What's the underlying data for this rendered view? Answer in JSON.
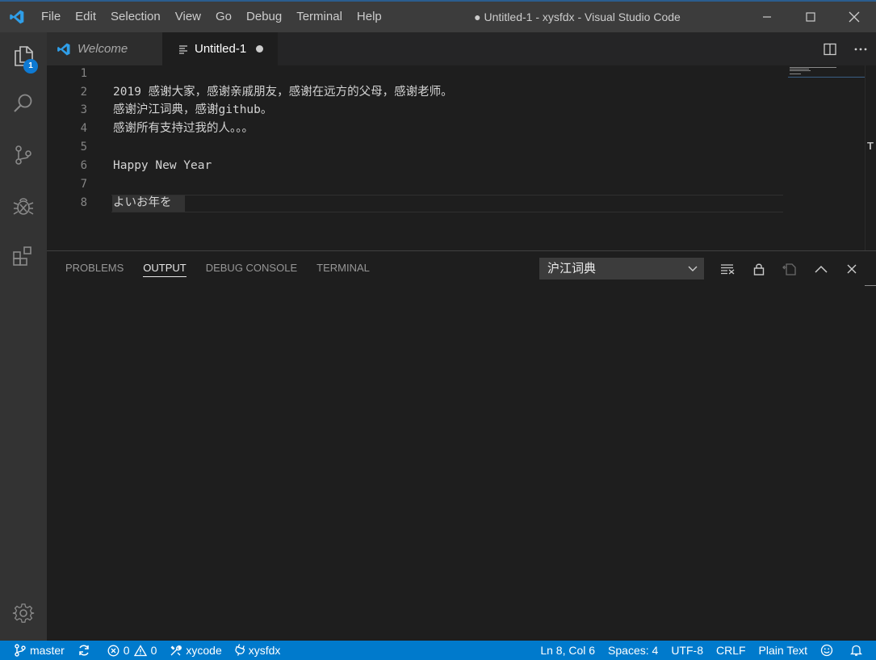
{
  "window": {
    "title": "● Untitled-1 - xysfdx - Visual Studio Code"
  },
  "menu": [
    "File",
    "Edit",
    "Selection",
    "View",
    "Go",
    "Debug",
    "Terminal",
    "Help"
  ],
  "activity_bar": {
    "explorer_badge": "1"
  },
  "tabs": [
    {
      "label": "Welcome",
      "active": false
    },
    {
      "label": "Untitled-1",
      "active": true,
      "dirty": true
    }
  ],
  "editor": {
    "line_numbers": [
      "1",
      "2",
      "3",
      "4",
      "5",
      "6",
      "7",
      "8"
    ],
    "lines": [
      "",
      "2019 感谢大家，感谢亲戚朋友，感谢在远方的父母，感谢老师。",
      "感谢沪江词典，感谢github。",
      "感谢所有支持过我的人。。。",
      "",
      "Happy New Year",
      "",
      "よいお年を"
    ],
    "overview_mark": "T"
  },
  "panel": {
    "tabs": [
      "PROBLEMS",
      "OUTPUT",
      "DEBUG CONSOLE",
      "TERMINAL"
    ],
    "active_tab": "OUTPUT",
    "output_channel": "沪江词典"
  },
  "status_bar": {
    "branch": "master",
    "errors": "0",
    "warnings": "0",
    "tool_item": "xycode",
    "remote_item": "xysfdx",
    "cursor": "Ln 8, Col 6",
    "indent": "Spaces: 4",
    "encoding": "UTF-8",
    "eol": "CRLF",
    "language": "Plain Text"
  },
  "colors": {
    "accent": "#007acc",
    "badge": "#0e7ad3",
    "logo": "#2f9ee8"
  }
}
